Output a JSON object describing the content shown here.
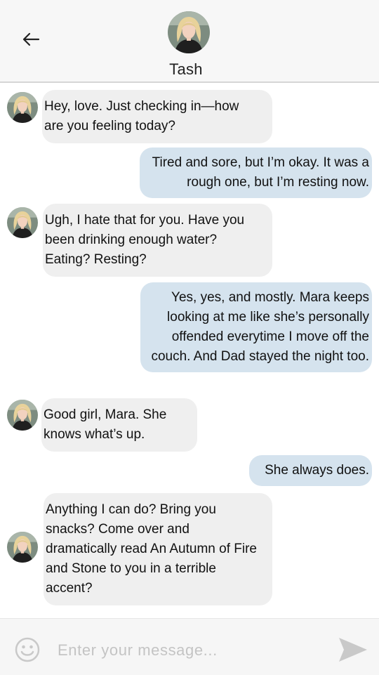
{
  "header": {
    "contact_name": "Tash"
  },
  "messages": [
    {
      "from": "contact",
      "text": "Hey, love. Just checking in—how are you feeling today?"
    },
    {
      "from": "me",
      "text": "Tired and sore, but I’m okay. It was a rough one, but I’m resting now."
    },
    {
      "from": "contact",
      "text": "Ugh, I hate that for you. Have you been drinking enough water? Eating? Resting?"
    },
    {
      "from": "me",
      "text": "Yes, yes, and mostly. Mara keeps looking at me like she’s personally offended everytime I move off the couch. And Dad stayed the night too."
    },
    {
      "from": "contact",
      "text": "Good girl, Mara. She knows what’s up."
    },
    {
      "from": "me",
      "text": "She always does."
    },
    {
      "from": "contact",
      "text": "Anything I can do? Bring you snacks? Come over and dramatically read An Autumn of Fire and Stone to you in a terrible accent?"
    }
  ],
  "composer": {
    "placeholder": "Enter your message...",
    "value": ""
  },
  "icons": {
    "back": "arrow-left-icon",
    "emoji": "smiley-icon",
    "send": "send-icon"
  },
  "colors": {
    "incoming_bubble": "#efefef",
    "outgoing_bubble": "#d5e3ee",
    "header_bg": "#f7f7f7"
  }
}
